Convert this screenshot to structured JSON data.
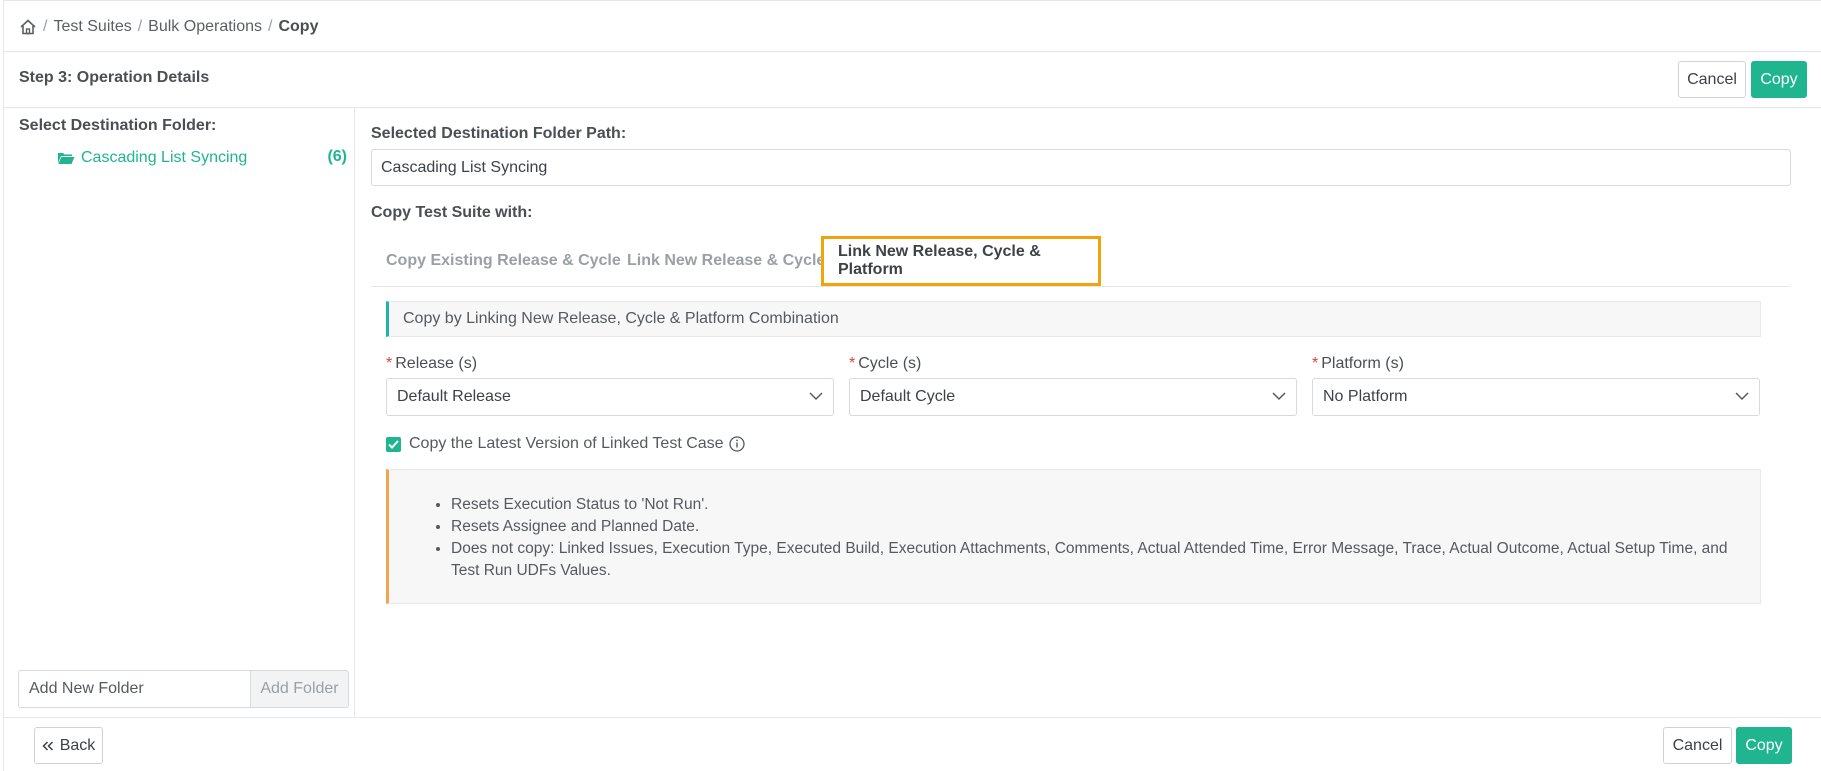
{
  "breadcrumb": {
    "home_icon": "home-icon",
    "items": [
      "Test Suites",
      "Bulk Operations"
    ],
    "current": "Copy",
    "separator": "/"
  },
  "step": {
    "title": "Step 3: Operation Details",
    "cancel_label": "Cancel",
    "copy_label": "Copy"
  },
  "left_panel": {
    "title": "Select Destination Folder:",
    "tree_item": {
      "icon": "folder-open-icon",
      "label": "Cascading List Syncing",
      "count": "(6)"
    },
    "add_folder_placeholder": "Add New Folder",
    "add_folder_button": "Add Folder"
  },
  "main": {
    "path_label": "Selected Destination Folder Path:",
    "path_value": "Cascading List Syncing",
    "copy_with_label": "Copy Test Suite with:",
    "tabs": [
      {
        "label": "Copy Existing Release & Cycle",
        "active": false
      },
      {
        "label": "Link New Release & Cycle",
        "active": false
      },
      {
        "label": "Link New Release, Cycle & Platform",
        "active": true
      }
    ],
    "banner": "Copy by Linking New Release, Cycle & Platform Combination",
    "fields": [
      {
        "required_mark": "*",
        "label": "Release (s)",
        "value": "Default Release"
      },
      {
        "required_mark": "*",
        "label": "Cycle (s)",
        "value": "Default Cycle"
      },
      {
        "required_mark": "*",
        "label": "Platform (s)",
        "value": "No Platform"
      }
    ],
    "checkbox": {
      "label": "Copy the Latest Version of Linked Test Case",
      "checked": true,
      "icon": "info-icon"
    },
    "notes": [
      "Resets Execution Status to 'Not Run'.",
      "Resets Assignee and Planned Date.",
      "Does not copy: Linked Issues, Execution Type, Executed Build, Execution Attachments, Comments, Actual Attended Time, Error Message, Trace, Actual Outcome, Actual Setup Time, and Test Run UDFs Values."
    ]
  },
  "footer": {
    "back_label": "Back",
    "back_icon": "double-chevron-left-icon",
    "cancel_label": "Cancel",
    "copy_label": "Copy"
  },
  "colors": {
    "primary": "#1fb58f",
    "highlight": "#f0a30a",
    "required": "#e0413b",
    "notes_border": "#f0a650"
  }
}
